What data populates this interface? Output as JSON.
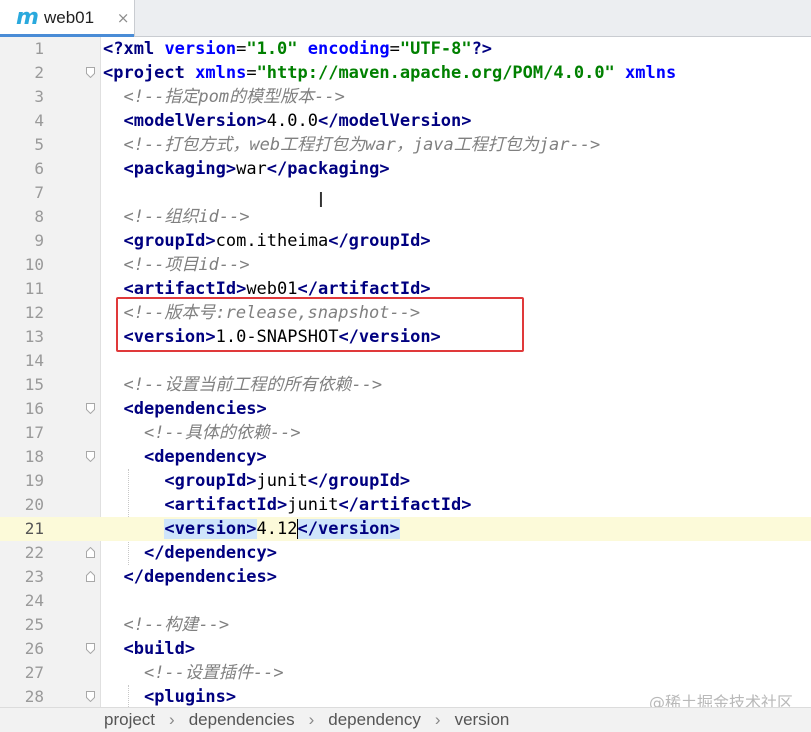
{
  "tab": {
    "icon": "m",
    "title": "web01",
    "close": "×"
  },
  "lines": [
    {
      "n": "1",
      "code": [
        [
          "pi",
          "<?"
        ],
        [
          "tag",
          "xml "
        ],
        [
          "attr",
          "version"
        ],
        [
          "txt",
          "="
        ],
        [
          "val",
          "\"1.0\" "
        ],
        [
          "attr",
          "encoding"
        ],
        [
          "txt",
          "="
        ],
        [
          "val",
          "\"UTF-8\""
        ],
        [
          "pi",
          "?>"
        ]
      ]
    },
    {
      "n": "2",
      "fold": "open",
      "code": [
        [
          "tag",
          "<project "
        ],
        [
          "attr",
          "xmlns"
        ],
        [
          "txt",
          "="
        ],
        [
          "val",
          "\"http://maven.apache.org/POM/4.0.0\" "
        ],
        [
          "attr",
          "xmlns"
        ]
      ]
    },
    {
      "n": "3",
      "code": [
        [
          "txt",
          "  "
        ],
        [
          "cm",
          "<!--指定pom的模型版本-->"
        ]
      ]
    },
    {
      "n": "4",
      "code": [
        [
          "txt",
          "  "
        ],
        [
          "tag",
          "<modelVersion>"
        ],
        [
          "txt",
          "4.0.0"
        ],
        [
          "tag",
          "</modelVersion>"
        ]
      ]
    },
    {
      "n": "5",
      "code": [
        [
          "txt",
          "  "
        ],
        [
          "cm",
          "<!--打包方式，web工程打包为war，java工程打包为jar-->"
        ]
      ]
    },
    {
      "n": "6",
      "code": [
        [
          "txt",
          "  "
        ],
        [
          "tag",
          "<packaging>"
        ],
        [
          "txt",
          "war"
        ],
        [
          "tag",
          "</packaging>"
        ]
      ]
    },
    {
      "n": "7",
      "code": []
    },
    {
      "n": "8",
      "code": [
        [
          "txt",
          "  "
        ],
        [
          "cm",
          "<!--组织id-->"
        ]
      ]
    },
    {
      "n": "9",
      "code": [
        [
          "txt",
          "  "
        ],
        [
          "tag",
          "<groupId>"
        ],
        [
          "txt",
          "com.itheima"
        ],
        [
          "tag",
          "</groupId>"
        ]
      ]
    },
    {
      "n": "10",
      "code": [
        [
          "txt",
          "  "
        ],
        [
          "cm",
          "<!--项目id-->"
        ]
      ]
    },
    {
      "n": "11",
      "code": [
        [
          "txt",
          "  "
        ],
        [
          "tag",
          "<artifactId>"
        ],
        [
          "txt",
          "web01"
        ],
        [
          "tag",
          "</artifactId>"
        ]
      ]
    },
    {
      "n": "12",
      "code": [
        [
          "txt",
          "  "
        ],
        [
          "cm",
          "<!--版本号:release,snapshot-->"
        ]
      ]
    },
    {
      "n": "13",
      "code": [
        [
          "txt",
          "  "
        ],
        [
          "tag",
          "<version>"
        ],
        [
          "txt",
          "1.0-SNAPSHOT"
        ],
        [
          "tag",
          "</version>"
        ]
      ]
    },
    {
      "n": "14",
      "code": []
    },
    {
      "n": "15",
      "code": [
        [
          "txt",
          "  "
        ],
        [
          "cm",
          "<!--设置当前工程的所有依赖-->"
        ]
      ]
    },
    {
      "n": "16",
      "fold": "open",
      "code": [
        [
          "txt",
          "  "
        ],
        [
          "tag",
          "<dependencies>"
        ]
      ]
    },
    {
      "n": "17",
      "code": [
        [
          "txt",
          "    "
        ],
        [
          "cm",
          "<!--具体的依赖-->"
        ]
      ]
    },
    {
      "n": "18",
      "fold": "open",
      "code": [
        [
          "txt",
          "    "
        ],
        [
          "tag",
          "<dependency>"
        ]
      ]
    },
    {
      "n": "19",
      "code": [
        [
          "txt",
          "      "
        ],
        [
          "tag",
          "<groupId>"
        ],
        [
          "txt",
          "junit"
        ],
        [
          "tag",
          "</groupId>"
        ]
      ]
    },
    {
      "n": "20",
      "code": [
        [
          "txt",
          "      "
        ],
        [
          "tag",
          "<artifactId>"
        ],
        [
          "txt",
          "junit"
        ],
        [
          "tag",
          "</artifactId>"
        ]
      ]
    },
    {
      "n": "21",
      "current": true,
      "code": [
        [
          "txt",
          "      "
        ],
        [
          "taghl",
          "<version>"
        ],
        [
          "txt",
          "4.12"
        ],
        [
          "caret",
          ""
        ],
        [
          "taghl",
          "</version>"
        ]
      ]
    },
    {
      "n": "22",
      "fold": "close",
      "code": [
        [
          "txt",
          "    "
        ],
        [
          "tag",
          "</dependency>"
        ]
      ]
    },
    {
      "n": "23",
      "fold": "close",
      "code": [
        [
          "txt",
          "  "
        ],
        [
          "tag",
          "</dependencies>"
        ]
      ]
    },
    {
      "n": "24",
      "code": []
    },
    {
      "n": "25",
      "code": [
        [
          "txt",
          "  "
        ],
        [
          "cm",
          "<!--构建-->"
        ]
      ]
    },
    {
      "n": "26",
      "fold": "open",
      "code": [
        [
          "txt",
          "  "
        ],
        [
          "tag",
          "<build>"
        ]
      ]
    },
    {
      "n": "27",
      "code": [
        [
          "txt",
          "    "
        ],
        [
          "cm",
          "<!--设置插件-->"
        ]
      ]
    },
    {
      "n": "28",
      "fold": "open",
      "code": [
        [
          "txt",
          "    "
        ],
        [
          "tag",
          "<plugins>"
        ]
      ]
    }
  ],
  "breadcrumb": [
    "project",
    "dependencies",
    "dependency",
    "version"
  ],
  "watermark": "@稀土掘金技术社区",
  "colors": {
    "tag": "#000080",
    "attribute": "#0000ff",
    "value": "#008000",
    "comment": "#808080",
    "current_line": "#fcfad9",
    "highlight": "#cfe5fb",
    "annotation_box": "#e0393a"
  }
}
